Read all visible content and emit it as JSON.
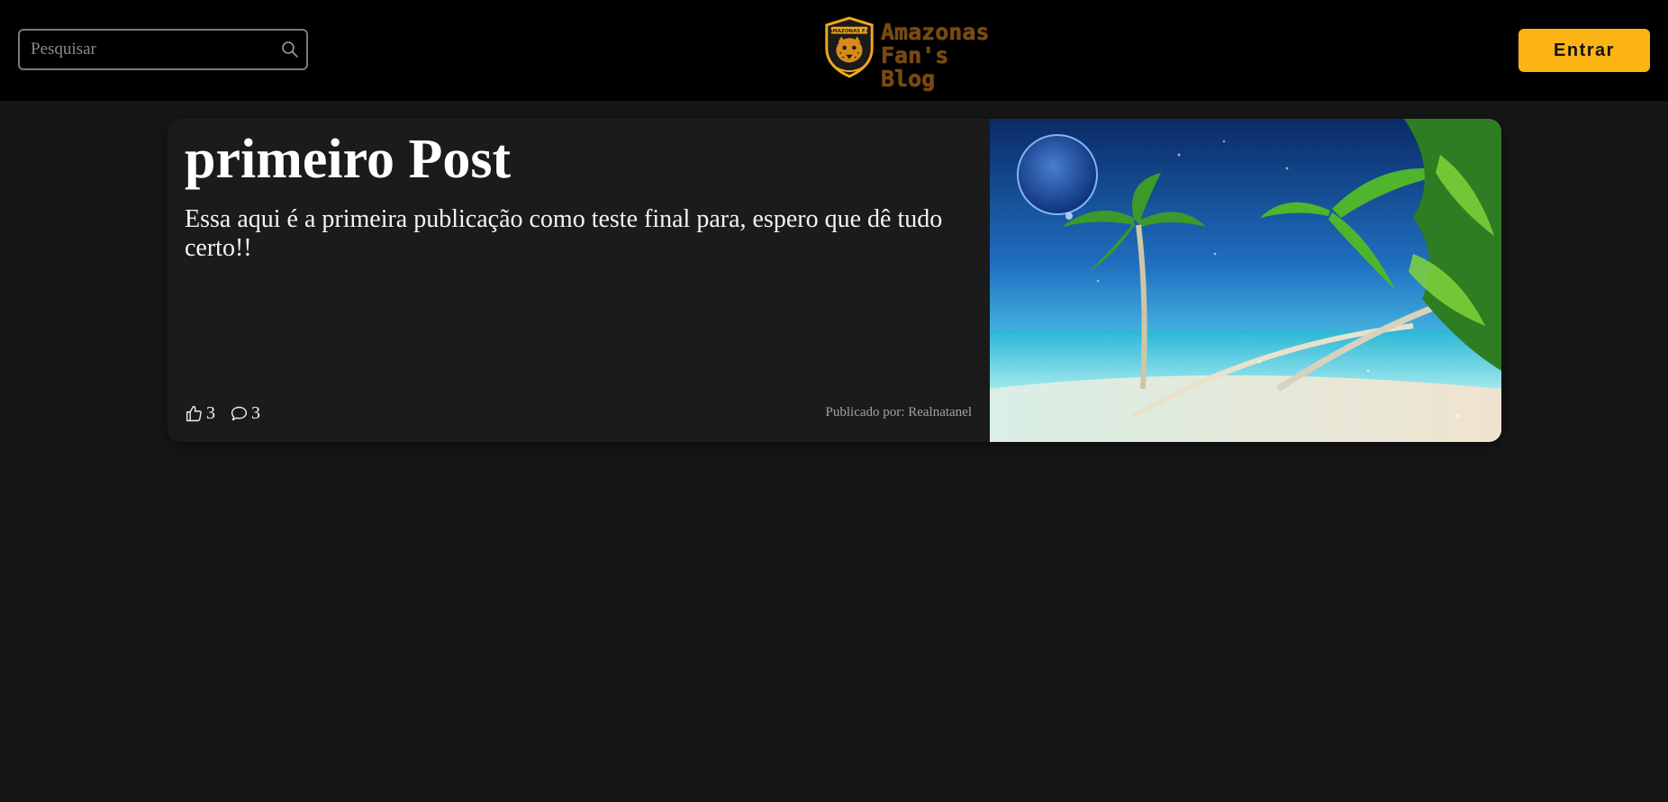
{
  "header": {
    "search_placeholder": "Pesquisar",
    "logo": {
      "badge_text": "AMAZONAS F.C",
      "line1": "Amazonas",
      "line2": "Fan's Blog"
    },
    "login_label": "Entrar"
  },
  "post": {
    "title": "primeiro Post",
    "excerpt": "Essa aqui é a primeira publicação como teste final para, espero que dê tudo certo!!",
    "likes": "3",
    "comments": "3",
    "author_line": "Publicado por: Realnatanel"
  },
  "colors": {
    "accent": "#fcb415",
    "page_background": "#161616",
    "header_background": "#000000",
    "card_background": "#1b1b1b"
  },
  "icons": [
    "search-icon",
    "thumbs-up-icon",
    "comment-icon",
    "jaguar-logo-icon"
  ]
}
